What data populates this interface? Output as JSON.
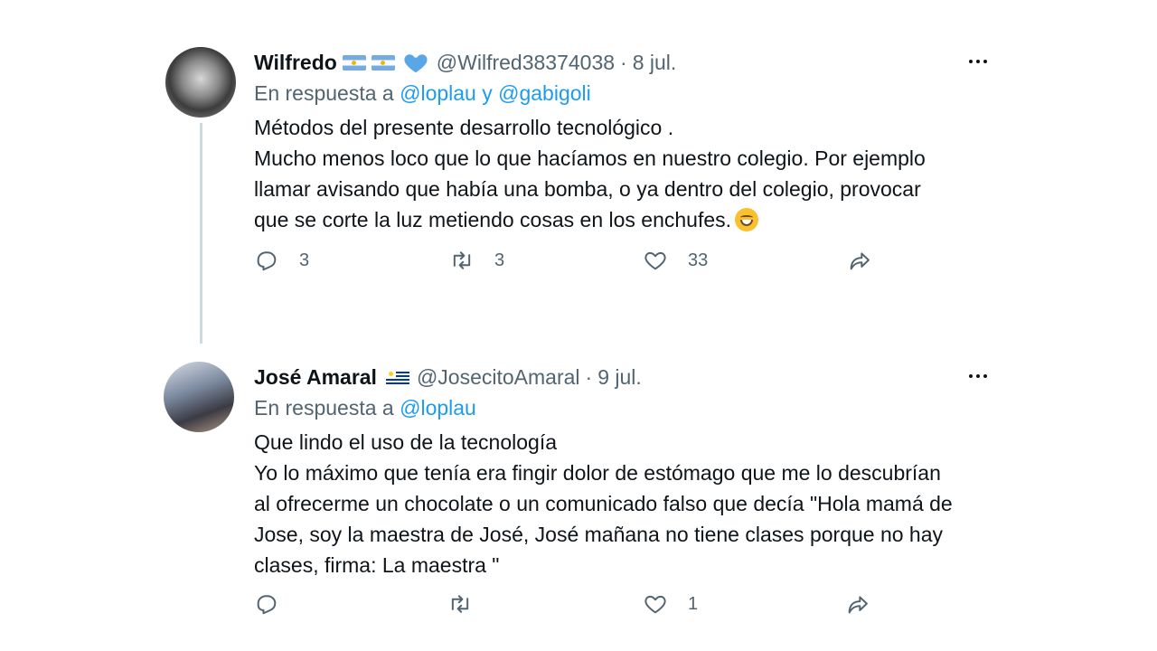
{
  "tweets": [
    {
      "name": "Wilfredo",
      "handle": "@Wilfred38374038",
      "date": "8 jul.",
      "reply_prefix": "En respuesta a",
      "mentions": [
        "@loplau",
        "@gabigoli"
      ],
      "mention_joiner": "y",
      "lines": [
        "Métodos del presente desarrollo tecnológico .",
        "Mucho menos loco que lo que hacíamos en nuestro colegio. Por ejemplo",
        "llamar avisando que había una bomba, o ya dentro del colegio, provocar",
        "que se corte la luz metiendo cosas en los enchufes."
      ],
      "emoji": "grinning-face-emoji",
      "counts": {
        "replies": "3",
        "retweets": "3",
        "likes": "33"
      }
    },
    {
      "name": "José Amaral",
      "handle": "@JosecitoAmaral",
      "date": "9 jul.",
      "reply_prefix": "En respuesta a",
      "mentions": [
        "@loplau"
      ],
      "lines": [
        "Que lindo el uso de la tecnología",
        "Yo lo máximo que tenía era fingir dolor de estómago que me lo descubrían",
        "al ofrecerme un chocolate o un comunicado falso que decía \"Hola mamá de",
        "Jose, soy la maestra de José, José mañana no tiene clases porque no hay",
        "clases, firma: La maestra \""
      ],
      "counts": {
        "replies": "",
        "retweets": "",
        "likes": "1"
      }
    }
  ],
  "separator": "·",
  "icons": {
    "reply": "reply-icon",
    "retweet": "retweet-icon",
    "like": "heart-icon",
    "share": "share-icon",
    "more": "more-icon"
  },
  "colors": {
    "text": "#0f1419",
    "secondary": "#536471",
    "link": "#1d9bf0",
    "thread_line": "#cfd9de",
    "verified_heart": "#5aa7e8"
  }
}
